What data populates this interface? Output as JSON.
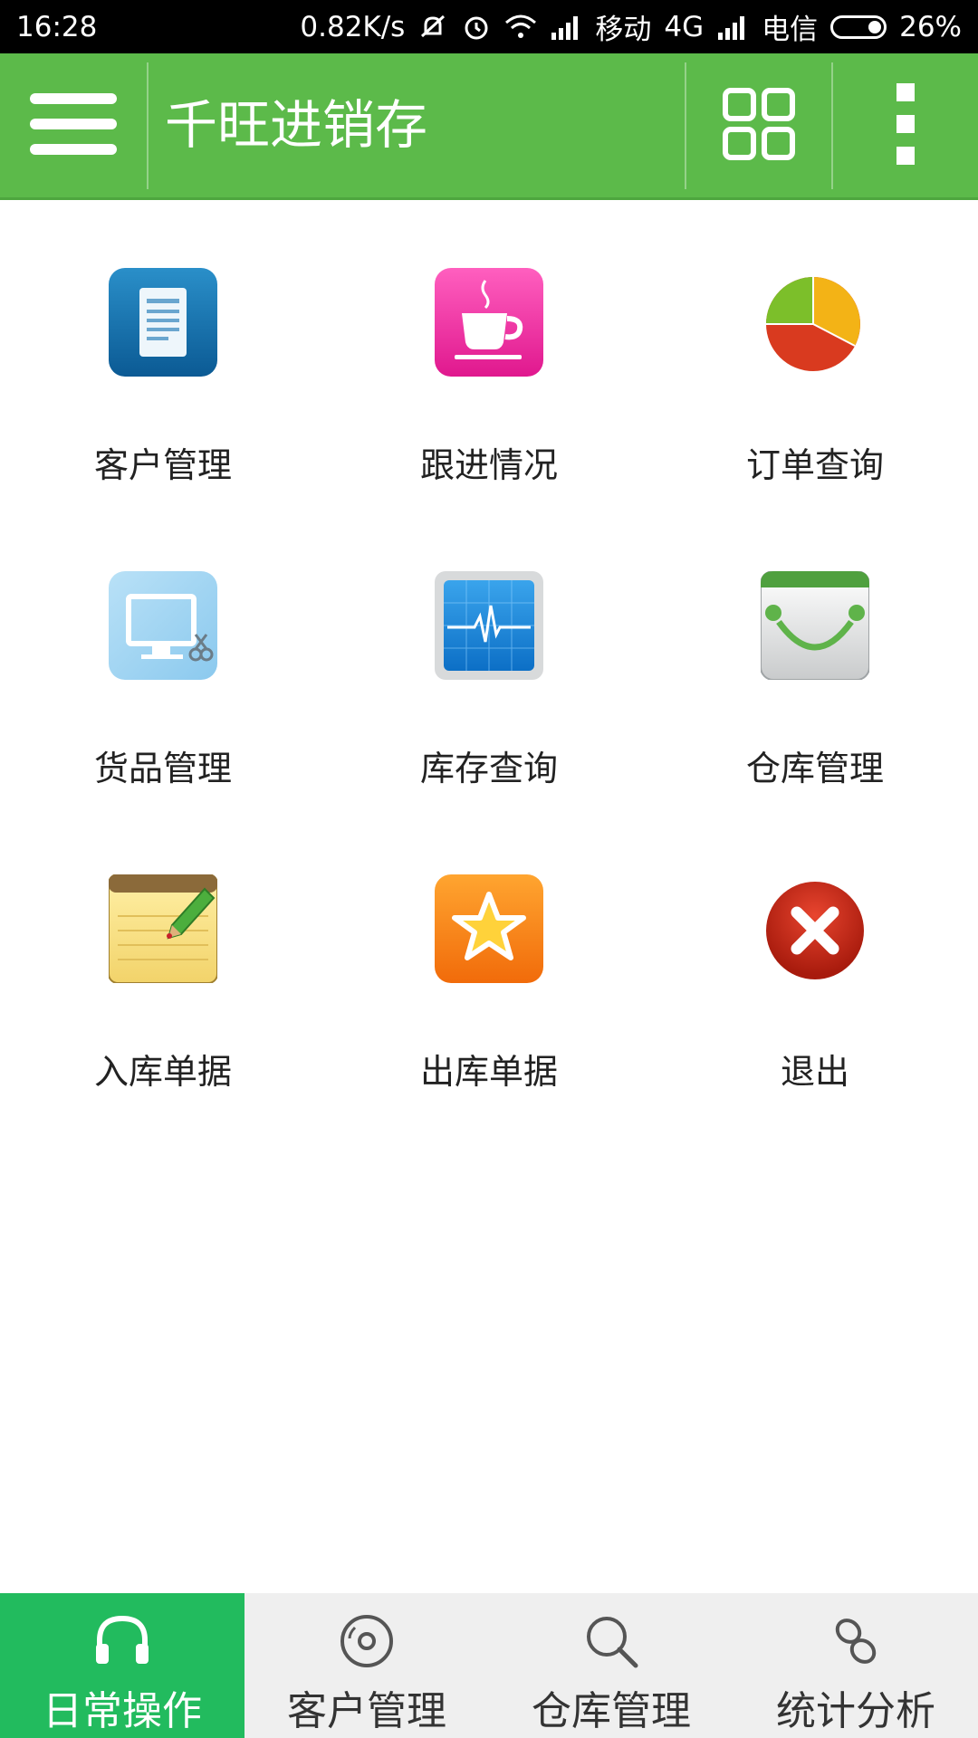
{
  "status_bar": {
    "time": "16:28",
    "network_speed": "0.82K/s",
    "carrier1": "移动",
    "network_type": "4G",
    "carrier2": "电信",
    "battery_percent": "26%",
    "battery_level": 0.26
  },
  "app_bar": {
    "title": "千旺进销存",
    "icons": [
      "menu-icon",
      "grid-icon",
      "more-vert-icon"
    ]
  },
  "menu_grid": {
    "items": [
      {
        "label": "客户管理",
        "icon": "document-icon"
      },
      {
        "label": "跟进情况",
        "icon": "coffee-cup-icon"
      },
      {
        "label": "订单查询",
        "icon": "pie-chart-icon"
      },
      {
        "label": "货品管理",
        "icon": "monitor-icon"
      },
      {
        "label": "库存查询",
        "icon": "pulse-monitor-icon"
      },
      {
        "label": "仓库管理",
        "icon": "smile-icon"
      },
      {
        "label": "入库单据",
        "icon": "notepad-icon"
      },
      {
        "label": "出库单据",
        "icon": "star-icon"
      },
      {
        "label": "退出",
        "icon": "exit-icon"
      }
    ]
  },
  "bottom_nav": {
    "active_index": 0,
    "tabs": [
      {
        "label": "日常操作",
        "icon": "headphones-icon"
      },
      {
        "label": "客户管理",
        "icon": "disc-icon"
      },
      {
        "label": "仓库管理",
        "icon": "search-icon"
      },
      {
        "label": "统计分析",
        "icon": "link-icon"
      }
    ]
  },
  "colors": {
    "app_bar": "#5cba4a",
    "active_tab": "#22bb5e",
    "bottom_bar": "#efefef"
  }
}
